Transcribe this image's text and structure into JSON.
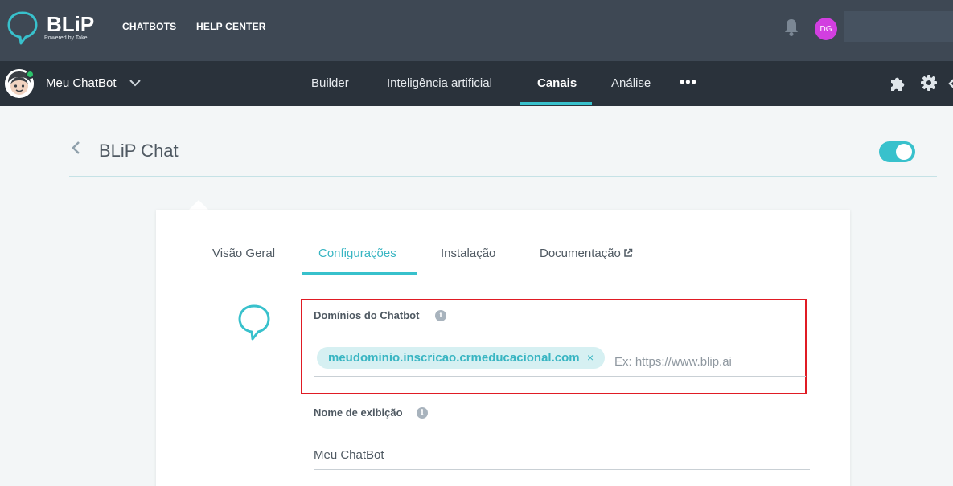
{
  "brand": {
    "name": "BLiP",
    "tagline": "Powered by Take",
    "accent_color": "#38c1cc"
  },
  "topnav": {
    "items": [
      "CHATBOTS",
      "HELP CENTER"
    ],
    "notification_icon": "bell-icon",
    "user_initials": "DG"
  },
  "botbar": {
    "bot_name": "Meu ChatBot",
    "tabs": [
      {
        "label": "Builder",
        "active": false
      },
      {
        "label": "Inteligência artificial",
        "active": false
      },
      {
        "label": "Canais",
        "active": true
      },
      {
        "label": "Análise",
        "active": false
      }
    ],
    "more_label": "•••",
    "icons": [
      "puzzle-icon",
      "gear-icon"
    ]
  },
  "page": {
    "title": "BLiP Chat",
    "enabled": true
  },
  "card": {
    "tabs": [
      {
        "label": "Visão Geral",
        "active": false
      },
      {
        "label": "Configurações",
        "active": true
      },
      {
        "label": "Instalação",
        "active": false
      },
      {
        "label": "Documentação",
        "active": false
      }
    ],
    "domains": {
      "label": "Domínios do Chatbot",
      "info": "i",
      "tags": [
        "meudominio.inscricao.crmeducacional.com"
      ],
      "remove_glyph": "×",
      "placeholder": "Ex: https://www.blip.ai"
    },
    "display_name": {
      "label": "Nome de exibição",
      "info": "i",
      "value": "Meu ChatBot"
    }
  }
}
